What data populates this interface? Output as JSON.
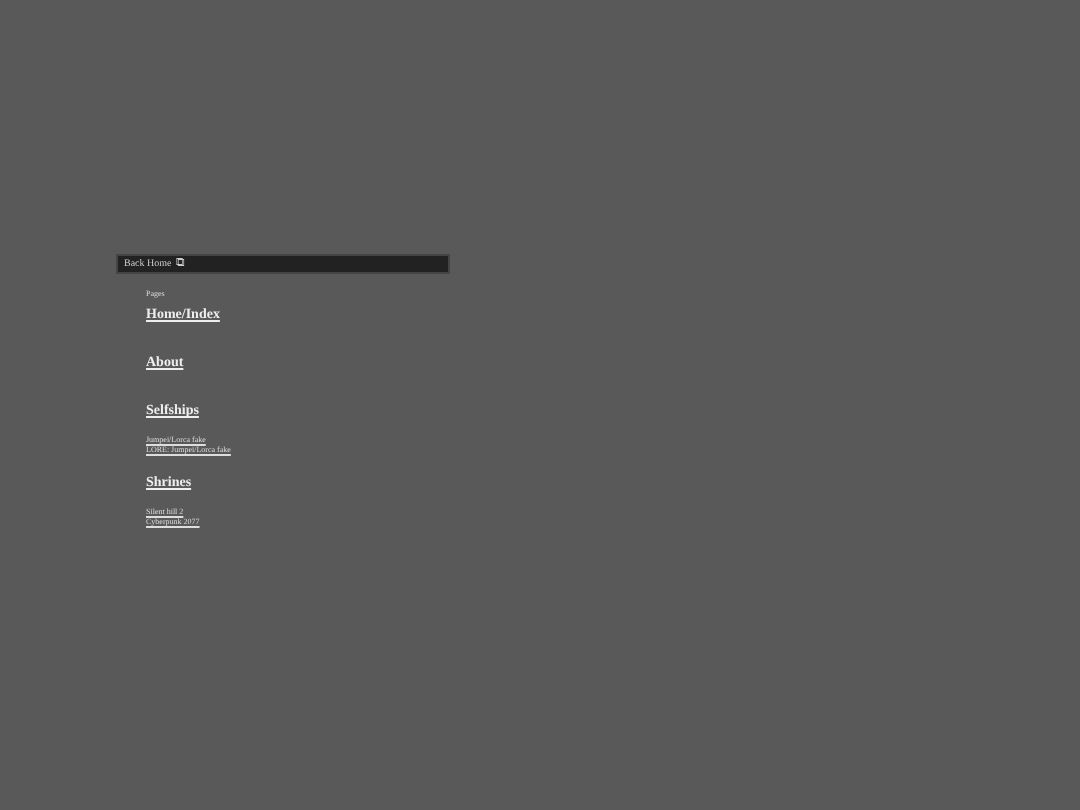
{
  "nav_bar": {
    "link": "Back Home",
    "icon_char": "⧉"
  },
  "sections_label": "Pages",
  "sections": [
    {
      "title": "Home/Index"
    },
    {
      "title": "About"
    },
    {
      "title": "Selfships",
      "links": [
        "Jumpei/Lorca fake",
        "LORE: Jumpei/Lorca fake"
      ]
    },
    {
      "title": "Shrines",
      "links": [
        "Silent hill 2",
        "Cyberpunk 2077"
      ]
    }
  ]
}
